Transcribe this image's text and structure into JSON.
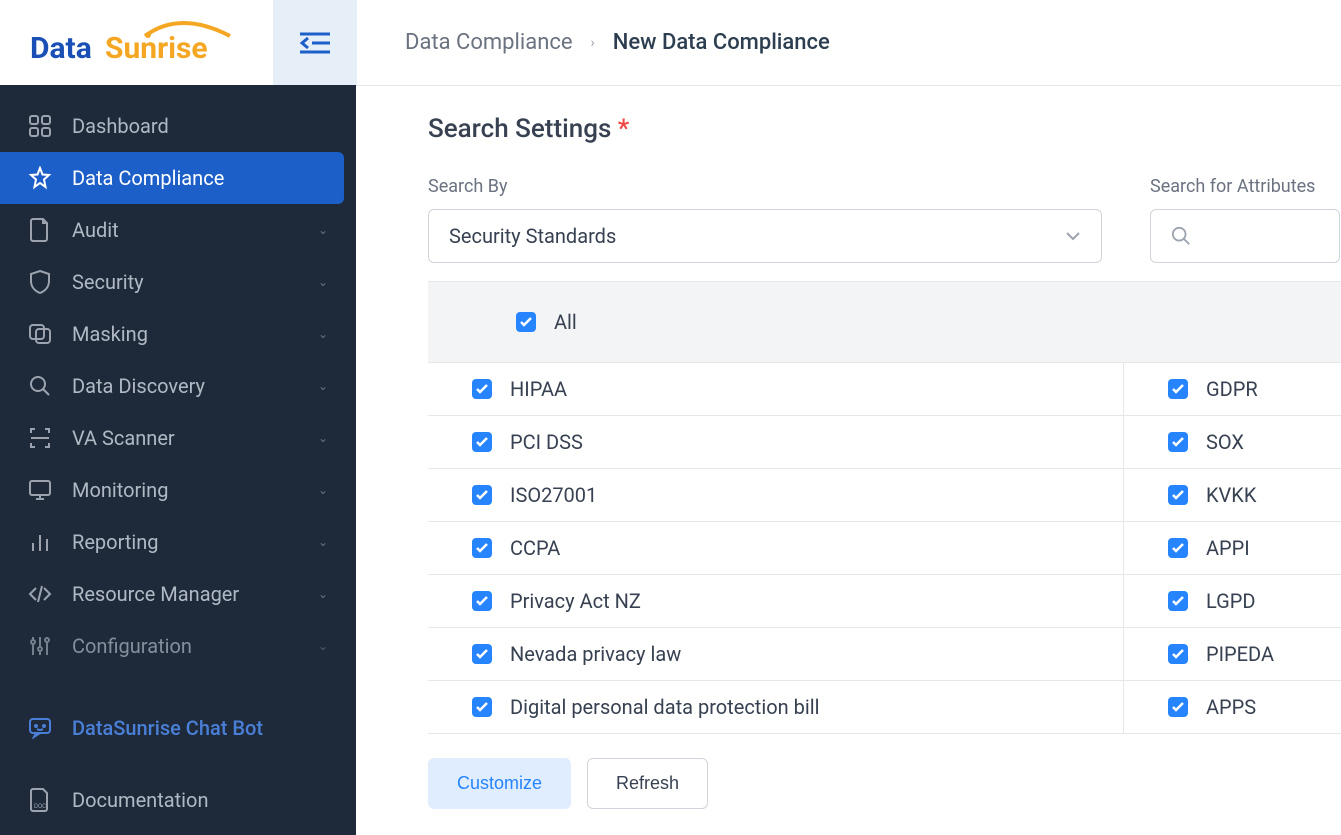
{
  "logo": {
    "part1": "Data",
    "part2": "Sunrise"
  },
  "breadcrumb": {
    "parent": "Data Compliance",
    "current": "New Data Compliance"
  },
  "sidebar": {
    "items": [
      {
        "label": "Dashboard",
        "icon": "dashboard",
        "expandable": false
      },
      {
        "label": "Data Compliance",
        "icon": "star",
        "expandable": false,
        "active": true
      },
      {
        "label": "Audit",
        "icon": "document",
        "expandable": true
      },
      {
        "label": "Security",
        "icon": "shield",
        "expandable": true
      },
      {
        "label": "Masking",
        "icon": "mask",
        "expandable": true
      },
      {
        "label": "Data Discovery",
        "icon": "search",
        "expandable": true
      },
      {
        "label": "VA Scanner",
        "icon": "scanner",
        "expandable": true
      },
      {
        "label": "Monitoring",
        "icon": "monitor",
        "expandable": true
      },
      {
        "label": "Reporting",
        "icon": "chart",
        "expandable": true
      },
      {
        "label": "Resource Manager",
        "icon": "code",
        "expandable": true
      },
      {
        "label": "Configuration",
        "icon": "sliders",
        "expandable": true
      }
    ],
    "chatbot": "DataSunrise Chat Bot",
    "docs": "Documentation"
  },
  "main": {
    "title": "Search Settings",
    "search_by_label": "Search By",
    "search_by_value": "Security Standards",
    "search_attr_label": "Search for Attributes",
    "all_label": "All",
    "standards": [
      {
        "left": "HIPAA",
        "right": "GDPR"
      },
      {
        "left": "PCI DSS",
        "right": "SOX"
      },
      {
        "left": "ISO27001",
        "right": "KVKK"
      },
      {
        "left": "CCPA",
        "right": "APPI"
      },
      {
        "left": "Privacy Act NZ",
        "right": "LGPD"
      },
      {
        "left": "Nevada privacy law",
        "right": "PIPEDA"
      },
      {
        "left": "Digital personal data protection bill",
        "right": "APPS"
      }
    ],
    "customize_btn": "Customize",
    "refresh_btn": "Refresh"
  }
}
